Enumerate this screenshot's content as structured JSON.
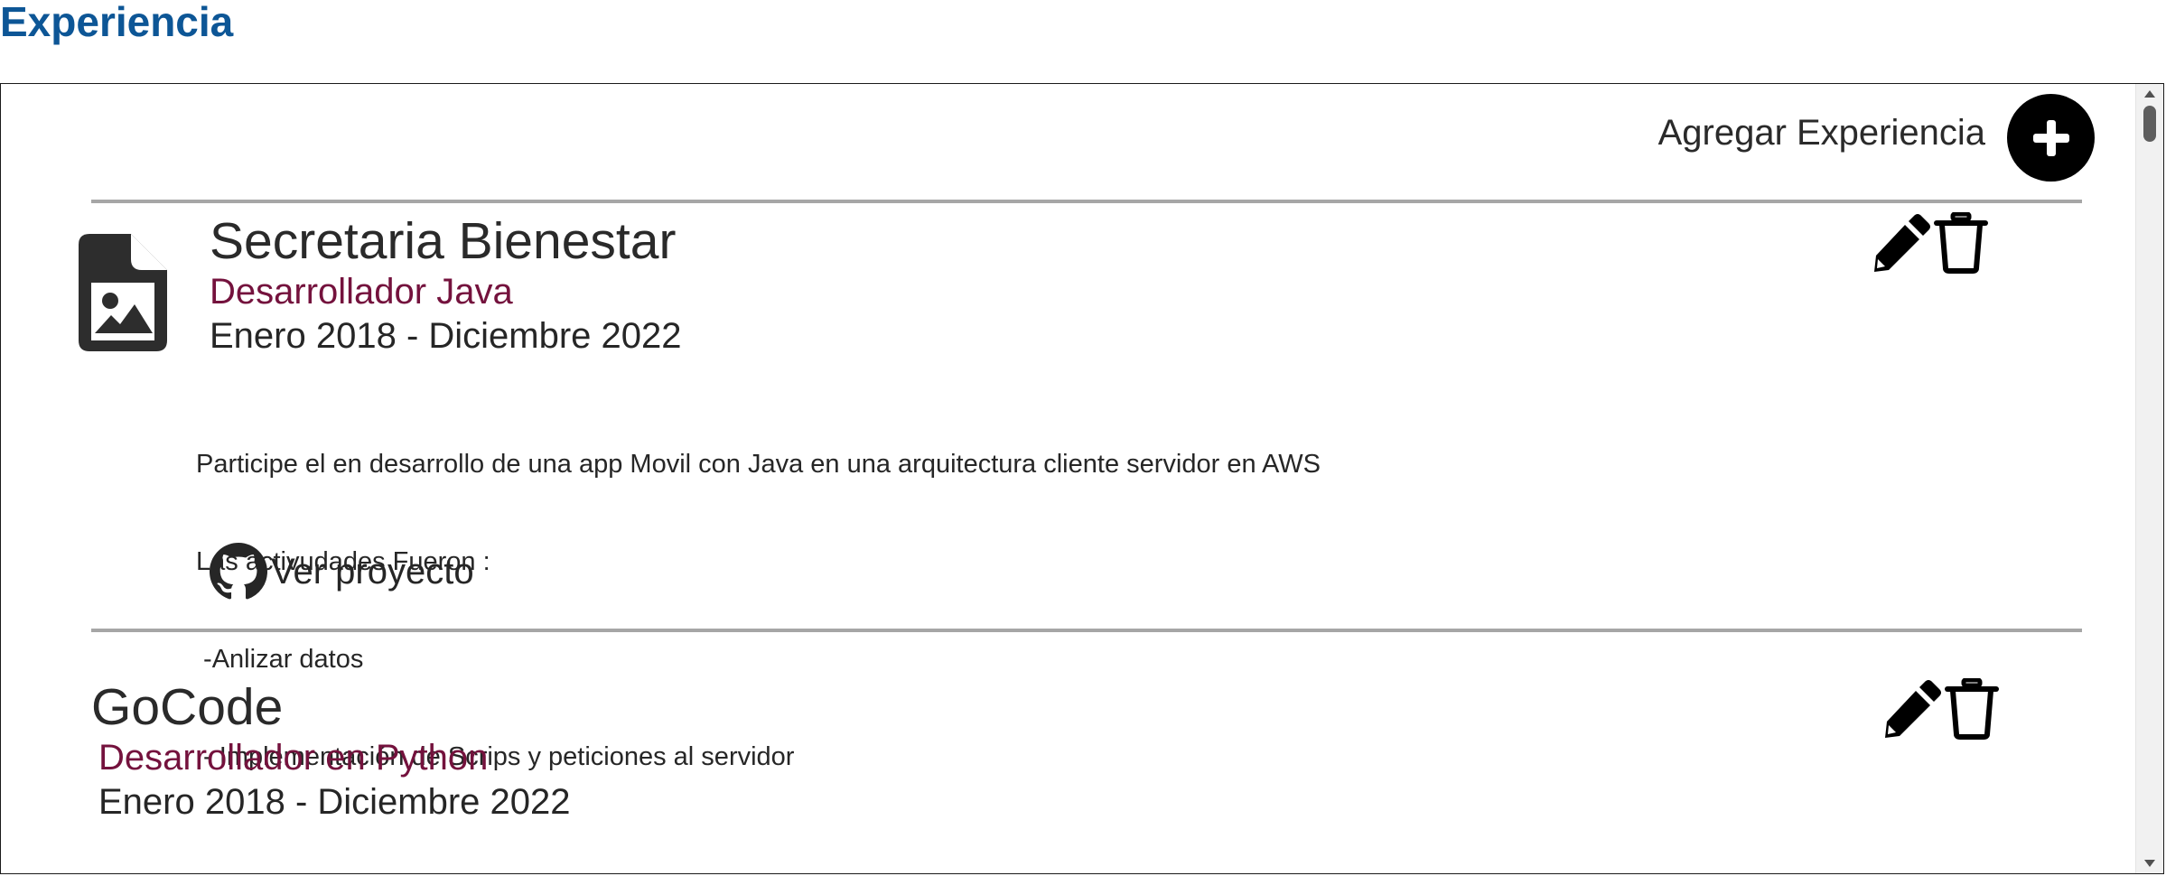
{
  "section": {
    "title": "Experiencia"
  },
  "toolbar": {
    "add_label": "Agregar Experiencia",
    "add_icon": "plus-circle-icon"
  },
  "entries": [
    {
      "company": "Secretaria Bienestar",
      "role": "Desarrollador Java",
      "dates": "Enero 2018 - Diciembre 2022",
      "logo_icon": "image-file-icon",
      "description": [
        "Participe el en desarrollo de una app Movil con Java en una arquitectura cliente servidor en AWS",
        "Las activudades Fueron :",
        " -Anlizar datos",
        " - Implementación de Scrips y peticiones al servidor"
      ],
      "link_label": "Ver proyecto",
      "link_icon": "github-icon",
      "edit_icon": "pencil-icon",
      "delete_icon": "trash-icon"
    },
    {
      "company": "GoCode",
      "role": "Desarrollador en Python",
      "dates": "Enero 2018 - Diciembre 2022",
      "edit_icon": "pencil-icon",
      "delete_icon": "trash-icon"
    }
  ],
  "colors": {
    "title": "#0d5696",
    "role": "#74123d",
    "divider": "#a6a6a6",
    "text": "#262626"
  }
}
